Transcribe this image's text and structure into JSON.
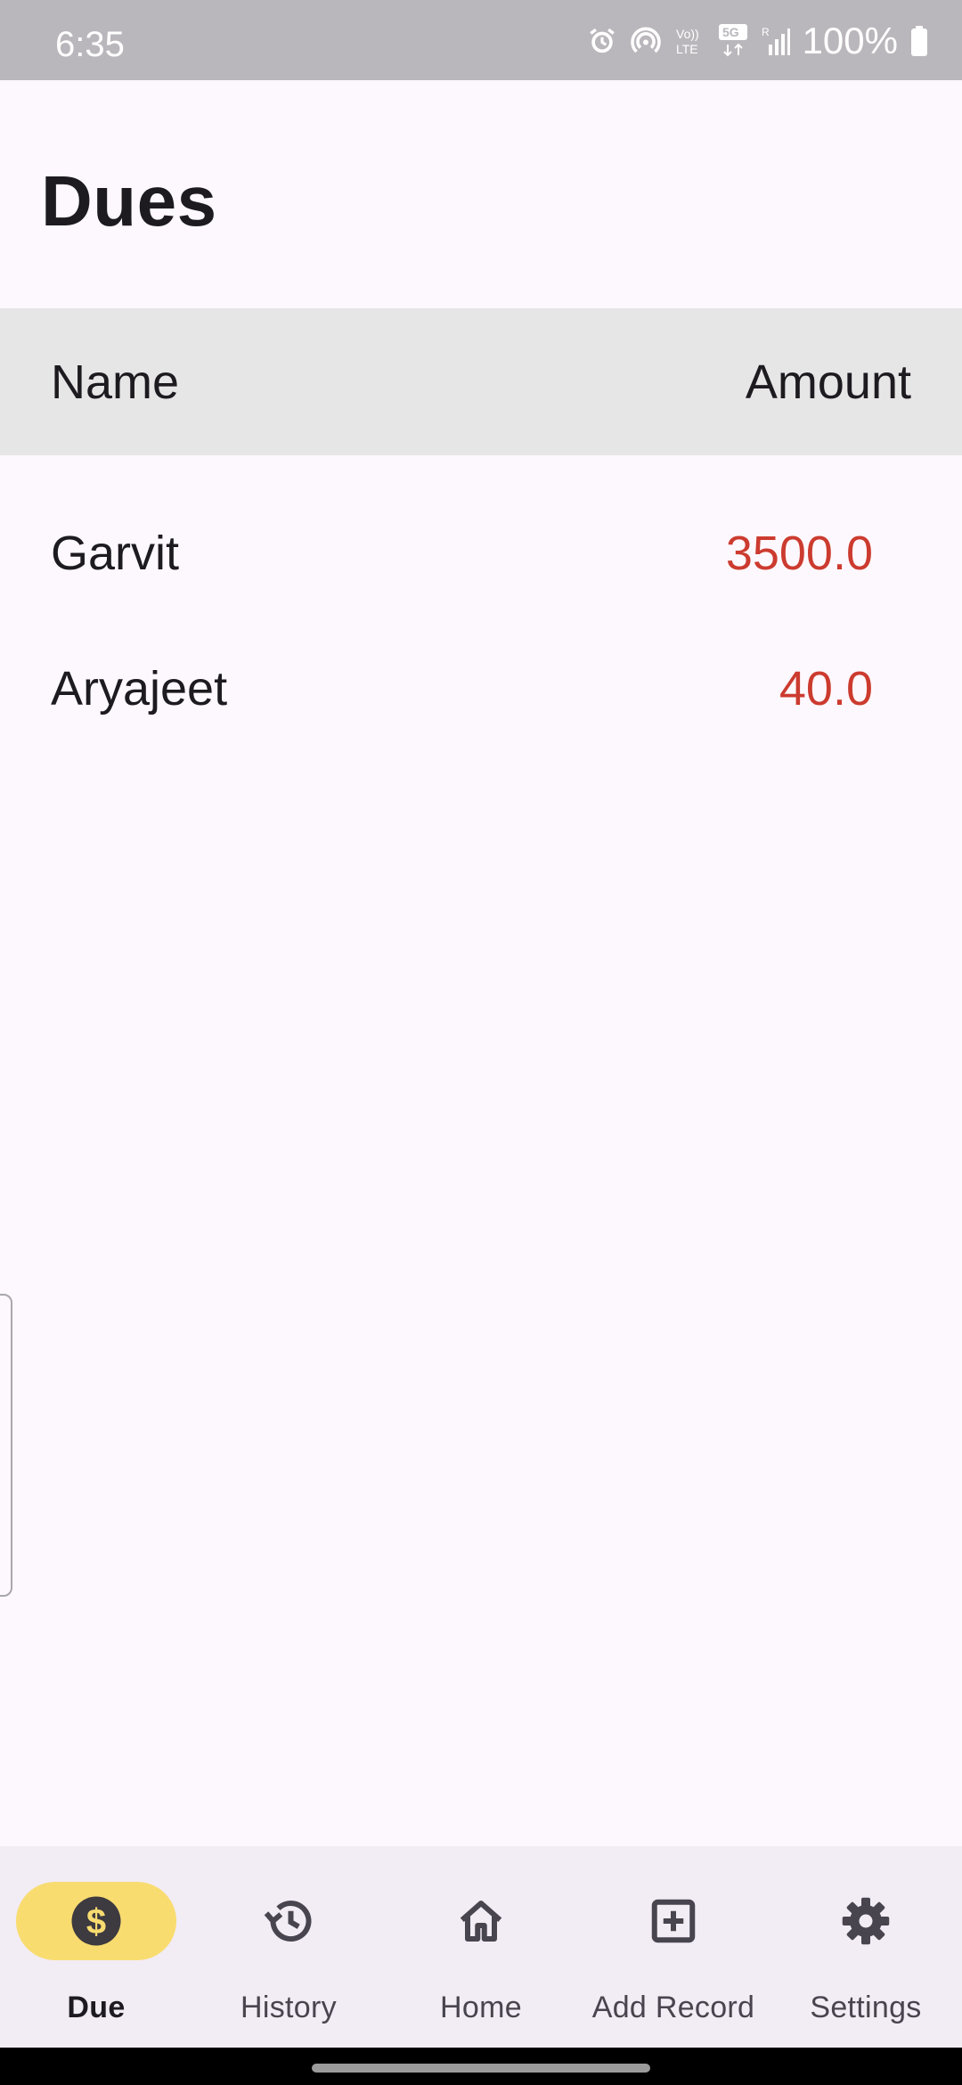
{
  "status_bar": {
    "time": "6:35",
    "battery": "100%",
    "icons": [
      "alarm-icon",
      "hotspot-icon",
      "volte-icon",
      "5g-icon",
      "signal-icon",
      "battery-icon"
    ]
  },
  "page": {
    "title": "Dues"
  },
  "table": {
    "headers": {
      "name": "Name",
      "amount": "Amount"
    },
    "rows": [
      {
        "name": "Garvit",
        "amount": "3500.0"
      },
      {
        "name": "Aryajeet",
        "amount": "40.0"
      }
    ]
  },
  "colors": {
    "amount_negative": "#cc3b2f",
    "active_indicator": "#f9dc70",
    "nav_background": "#f2ecf5",
    "header_background": "#e7e6e7"
  },
  "bottom_nav": {
    "active": "due",
    "items": [
      {
        "label": "Due",
        "icon": "dollar-icon"
      },
      {
        "label": "History",
        "icon": "history-icon"
      },
      {
        "label": "Home",
        "icon": "home-icon"
      },
      {
        "label": "Add Record",
        "icon": "add-box-icon"
      },
      {
        "label": "Settings",
        "icon": "gear-icon"
      }
    ]
  }
}
